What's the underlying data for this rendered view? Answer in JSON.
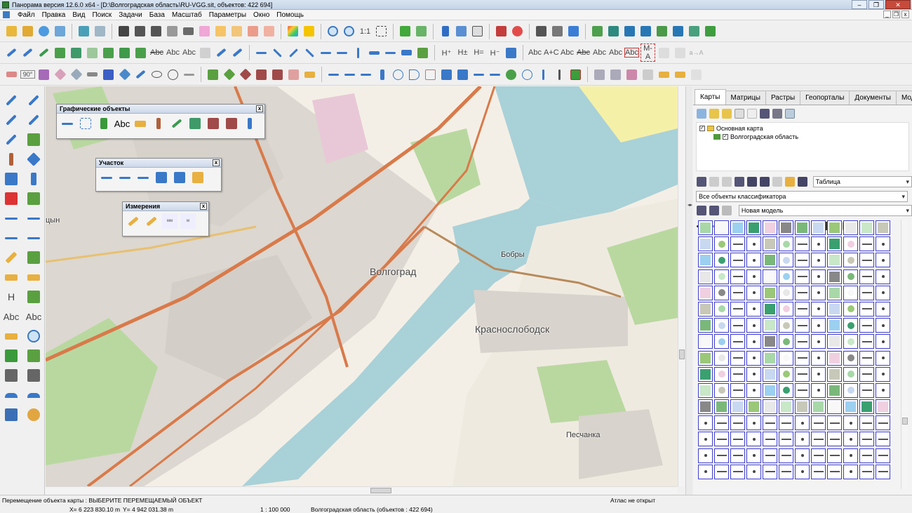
{
  "window": {
    "title": "Панорама версия 12.6.0 x64 - [D:\\Волгоградская область\\RU-VGG.sit, объектов: 422 694]",
    "buttons": [
      "–",
      "❐",
      "✕"
    ]
  },
  "menu": {
    "items": [
      "Файл",
      "Правка",
      "Вид",
      "Поиск",
      "Задачи",
      "База",
      "Масштаб",
      "Параметры",
      "Окно",
      "Помощь"
    ],
    "mdi_buttons": [
      "_",
      "❐",
      "x"
    ]
  },
  "toolbar1": {
    "scale_button": "1:1"
  },
  "toolbar2": {
    "text_labels": [
      "Abc",
      "Abc",
      "Abc",
      "H⁺",
      "H±",
      "H=",
      "H⁻",
      "Abc",
      "A+C",
      "Abc",
      "Abc",
      "Abc",
      "Abc",
      "Abc",
      "M-A",
      "a→A"
    ]
  },
  "toolbar3": {
    "angle_label": "90°"
  },
  "lefttb": {
    "text_labels": [
      "H",
      "Abc",
      "Abc"
    ]
  },
  "panels": {
    "graphic": {
      "title": "Графические объекты",
      "text_label": "Abc",
      "close": "x"
    },
    "plot": {
      "title": "Участок",
      "close": "x"
    },
    "measure": {
      "title": "Измерения",
      "close": "x",
      "labels": [
        "мм",
        "м"
      ]
    }
  },
  "map": {
    "labels": {
      "city": "Волгоград",
      "krasnoslobodsk": "Краснослободск",
      "bobry": "Бобры",
      "peschanka": "Песчанка",
      "edge": "цын"
    },
    "colors": {
      "water": "#a9d1d8",
      "land": "#f4efe6",
      "urban": "#dcd7d0",
      "forest": "#b9d8a0",
      "main_road": "#d97a4a",
      "secondary_road": "#e8c070",
      "sand": "#f5f0a8",
      "industrial": "#e8c8d6"
    }
  },
  "splitter": {
    "arrow": "◂▸"
  },
  "right_panel": {
    "tabs": [
      "Карты",
      "Матрицы",
      "Растры",
      "Геопорталы",
      "Документы",
      "Модели"
    ],
    "active_tab": "Карты",
    "tree": {
      "root": "Основная карта",
      "child": "Волгоградская область",
      "check": "✓"
    },
    "view_select": "Таблица",
    "objects_select": "Все объекты классификатора",
    "model_select": "Новая модель"
  },
  "status": {
    "message": "Перемещение объекта карты : ВЫБЕРИТЕ ПЕРЕМЕЩАЕМЫЙ ОБЪЕКТ",
    "atlas": "Атлас не открыт",
    "x": "X= 6 223 830.10 m",
    "y": "Y= 4 942 031.38 m",
    "scale": "1 : 100 000",
    "region": "Волгоградская область  (объектов : 422 694)"
  }
}
